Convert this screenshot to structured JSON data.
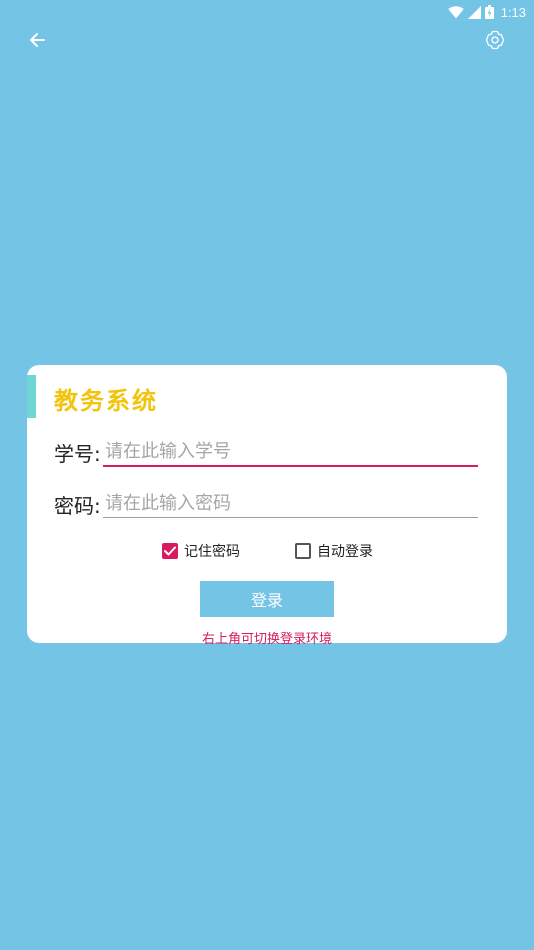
{
  "status_bar": {
    "time": "1:13",
    "icons": [
      "wifi-icon",
      "signal-icon",
      "battery-icon"
    ]
  },
  "top_bar": {
    "back_icon": "arrow-left-icon",
    "settings_icon": "gear-icon"
  },
  "login_card": {
    "title": "教务系统",
    "student_id": {
      "label": "学号:",
      "placeholder": "请在此输入学号",
      "value": ""
    },
    "password": {
      "label": "密码:",
      "placeholder": "请在此输入密码",
      "value": ""
    },
    "remember_password": {
      "label": "记住密码",
      "checked": true
    },
    "auto_login": {
      "label": "自动登录",
      "checked": false
    },
    "login_button": "登录",
    "hint": "右上角可切换登录环境"
  },
  "colors": {
    "background": "#74c4e6",
    "card": "#ffffff",
    "title": "#f2c40c",
    "accent": "#d81b60",
    "title_bar": "#6fd6d4",
    "button": "#74c4e6"
  }
}
